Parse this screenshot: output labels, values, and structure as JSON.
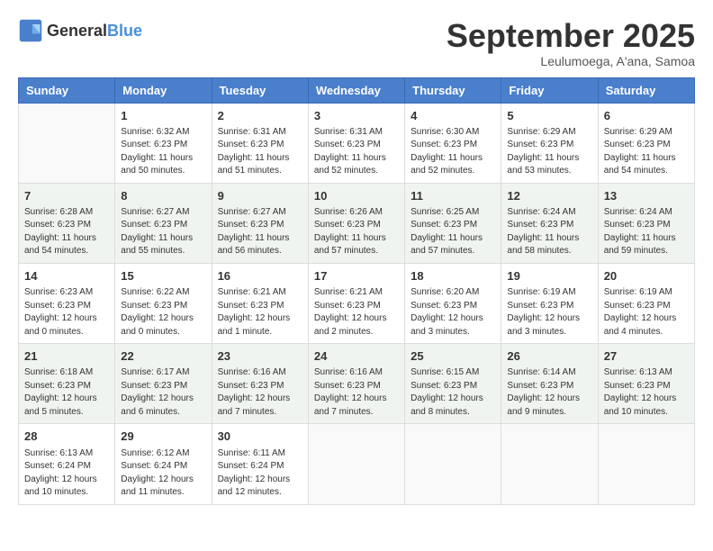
{
  "logo": {
    "general": "General",
    "blue": "Blue"
  },
  "title": {
    "month": "September 2025",
    "location": "Leulumoega, A'ana, Samoa"
  },
  "columns": [
    "Sunday",
    "Monday",
    "Tuesday",
    "Wednesday",
    "Thursday",
    "Friday",
    "Saturday"
  ],
  "weeks": [
    [
      {
        "day": "",
        "info": ""
      },
      {
        "day": "1",
        "info": "Sunrise: 6:32 AM\nSunset: 6:23 PM\nDaylight: 11 hours\nand 50 minutes."
      },
      {
        "day": "2",
        "info": "Sunrise: 6:31 AM\nSunset: 6:23 PM\nDaylight: 11 hours\nand 51 minutes."
      },
      {
        "day": "3",
        "info": "Sunrise: 6:31 AM\nSunset: 6:23 PM\nDaylight: 11 hours\nand 52 minutes."
      },
      {
        "day": "4",
        "info": "Sunrise: 6:30 AM\nSunset: 6:23 PM\nDaylight: 11 hours\nand 52 minutes."
      },
      {
        "day": "5",
        "info": "Sunrise: 6:29 AM\nSunset: 6:23 PM\nDaylight: 11 hours\nand 53 minutes."
      },
      {
        "day": "6",
        "info": "Sunrise: 6:29 AM\nSunset: 6:23 PM\nDaylight: 11 hours\nand 54 minutes."
      }
    ],
    [
      {
        "day": "7",
        "info": "Sunrise: 6:28 AM\nSunset: 6:23 PM\nDaylight: 11 hours\nand 54 minutes."
      },
      {
        "day": "8",
        "info": "Sunrise: 6:27 AM\nSunset: 6:23 PM\nDaylight: 11 hours\nand 55 minutes."
      },
      {
        "day": "9",
        "info": "Sunrise: 6:27 AM\nSunset: 6:23 PM\nDaylight: 11 hours\nand 56 minutes."
      },
      {
        "day": "10",
        "info": "Sunrise: 6:26 AM\nSunset: 6:23 PM\nDaylight: 11 hours\nand 57 minutes."
      },
      {
        "day": "11",
        "info": "Sunrise: 6:25 AM\nSunset: 6:23 PM\nDaylight: 11 hours\nand 57 minutes."
      },
      {
        "day": "12",
        "info": "Sunrise: 6:24 AM\nSunset: 6:23 PM\nDaylight: 11 hours\nand 58 minutes."
      },
      {
        "day": "13",
        "info": "Sunrise: 6:24 AM\nSunset: 6:23 PM\nDaylight: 11 hours\nand 59 minutes."
      }
    ],
    [
      {
        "day": "14",
        "info": "Sunrise: 6:23 AM\nSunset: 6:23 PM\nDaylight: 12 hours\nand 0 minutes."
      },
      {
        "day": "15",
        "info": "Sunrise: 6:22 AM\nSunset: 6:23 PM\nDaylight: 12 hours\nand 0 minutes."
      },
      {
        "day": "16",
        "info": "Sunrise: 6:21 AM\nSunset: 6:23 PM\nDaylight: 12 hours\nand 1 minute."
      },
      {
        "day": "17",
        "info": "Sunrise: 6:21 AM\nSunset: 6:23 PM\nDaylight: 12 hours\nand 2 minutes."
      },
      {
        "day": "18",
        "info": "Sunrise: 6:20 AM\nSunset: 6:23 PM\nDaylight: 12 hours\nand 3 minutes."
      },
      {
        "day": "19",
        "info": "Sunrise: 6:19 AM\nSunset: 6:23 PM\nDaylight: 12 hours\nand 3 minutes."
      },
      {
        "day": "20",
        "info": "Sunrise: 6:19 AM\nSunset: 6:23 PM\nDaylight: 12 hours\nand 4 minutes."
      }
    ],
    [
      {
        "day": "21",
        "info": "Sunrise: 6:18 AM\nSunset: 6:23 PM\nDaylight: 12 hours\nand 5 minutes."
      },
      {
        "day": "22",
        "info": "Sunrise: 6:17 AM\nSunset: 6:23 PM\nDaylight: 12 hours\nand 6 minutes."
      },
      {
        "day": "23",
        "info": "Sunrise: 6:16 AM\nSunset: 6:23 PM\nDaylight: 12 hours\nand 7 minutes."
      },
      {
        "day": "24",
        "info": "Sunrise: 6:16 AM\nSunset: 6:23 PM\nDaylight: 12 hours\nand 7 minutes."
      },
      {
        "day": "25",
        "info": "Sunrise: 6:15 AM\nSunset: 6:23 PM\nDaylight: 12 hours\nand 8 minutes."
      },
      {
        "day": "26",
        "info": "Sunrise: 6:14 AM\nSunset: 6:23 PM\nDaylight: 12 hours\nand 9 minutes."
      },
      {
        "day": "27",
        "info": "Sunrise: 6:13 AM\nSunset: 6:23 PM\nDaylight: 12 hours\nand 10 minutes."
      }
    ],
    [
      {
        "day": "28",
        "info": "Sunrise: 6:13 AM\nSunset: 6:24 PM\nDaylight: 12 hours\nand 10 minutes."
      },
      {
        "day": "29",
        "info": "Sunrise: 6:12 AM\nSunset: 6:24 PM\nDaylight: 12 hours\nand 11 minutes."
      },
      {
        "day": "30",
        "info": "Sunrise: 6:11 AM\nSunset: 6:24 PM\nDaylight: 12 hours\nand 12 minutes."
      },
      {
        "day": "",
        "info": ""
      },
      {
        "day": "",
        "info": ""
      },
      {
        "day": "",
        "info": ""
      },
      {
        "day": "",
        "info": ""
      }
    ]
  ]
}
